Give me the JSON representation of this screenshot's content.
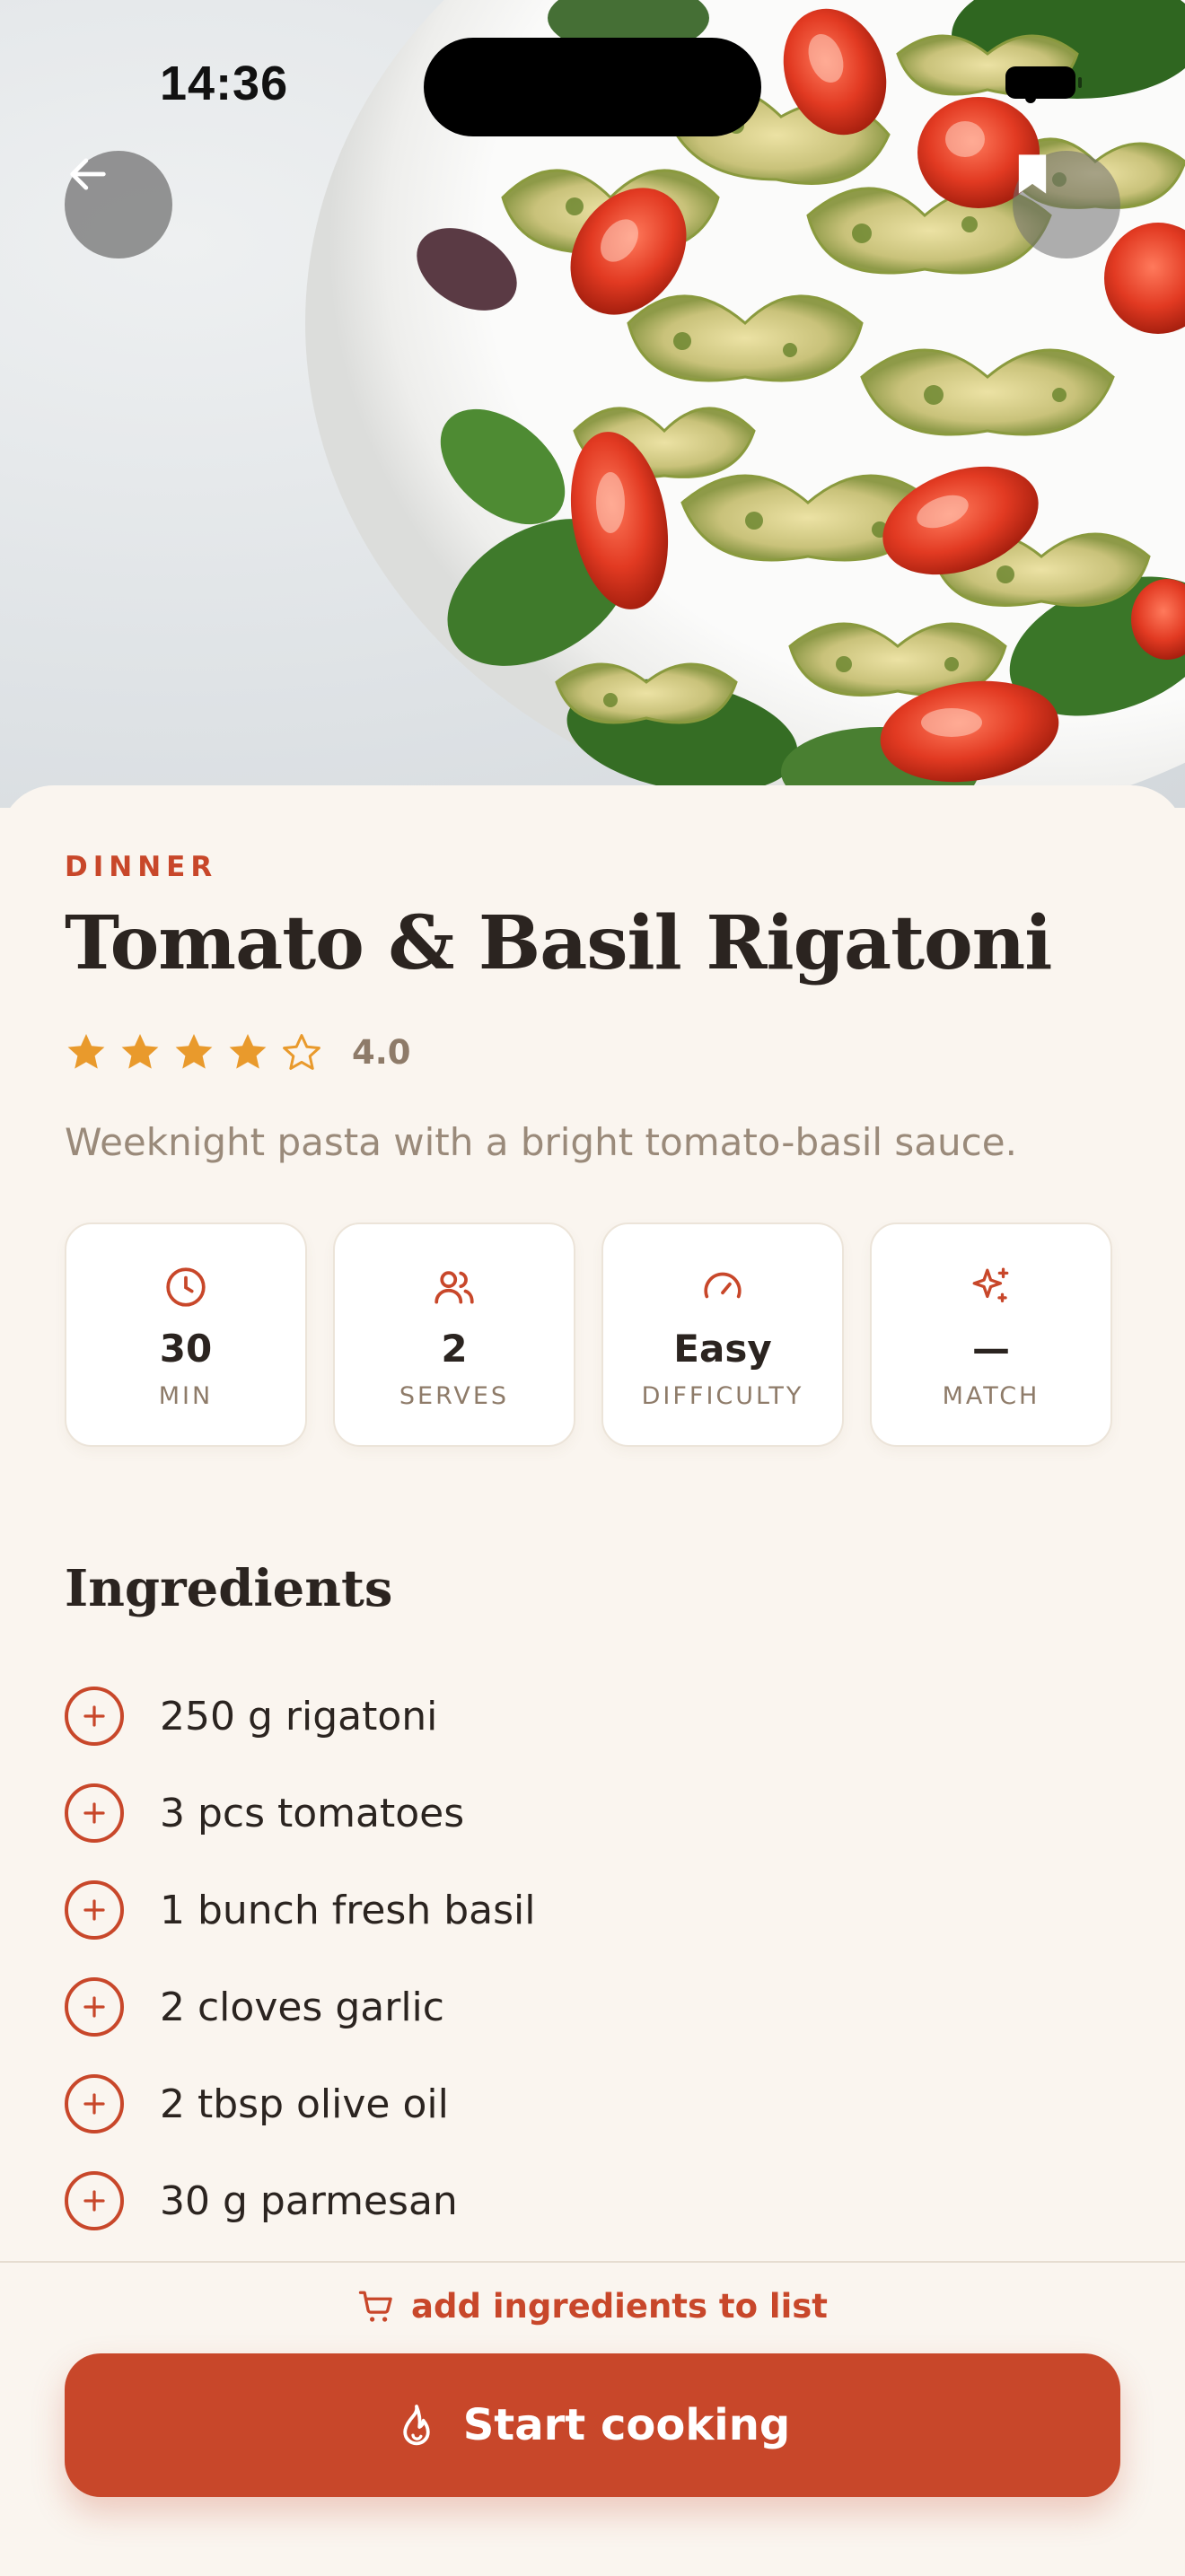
{
  "status_bar": {
    "time": "14:36"
  },
  "hero": {
    "image_description_icon": "pasta-photo",
    "back_icon": "arrow-left-icon",
    "bookmark_icon": "bookmark-icon"
  },
  "recipe": {
    "category": "DINNER",
    "title": "Tomato & Basil Rigatoni",
    "rating": {
      "value": "4.0",
      "stars_filled": 4,
      "stars_total": 5
    },
    "description": "Weeknight pasta with a bright tomato-basil sauce."
  },
  "stats": [
    {
      "icon": "clock-icon",
      "value": "30",
      "label": "MIN"
    },
    {
      "icon": "users-icon",
      "value": "2",
      "label": "SERVES"
    },
    {
      "icon": "gauge-icon",
      "value": "Easy",
      "label": "DIFFICULTY"
    },
    {
      "icon": "sparkle-icon",
      "value": "—",
      "label": "MATCH"
    }
  ],
  "ingredients_section": {
    "title": "Ingredients",
    "items": [
      "250 g rigatoni",
      "3 pcs tomatoes",
      "1 bunch fresh basil",
      "2 cloves garlic",
      "2 tbsp olive oil",
      "30 g parmesan"
    ]
  },
  "actions": {
    "add_to_list": "add ingredients to list",
    "start_cooking": "Start cooking"
  },
  "colors": {
    "accent": "#c8472a",
    "background": "#faf5ef",
    "star": "#e99a2c"
  }
}
